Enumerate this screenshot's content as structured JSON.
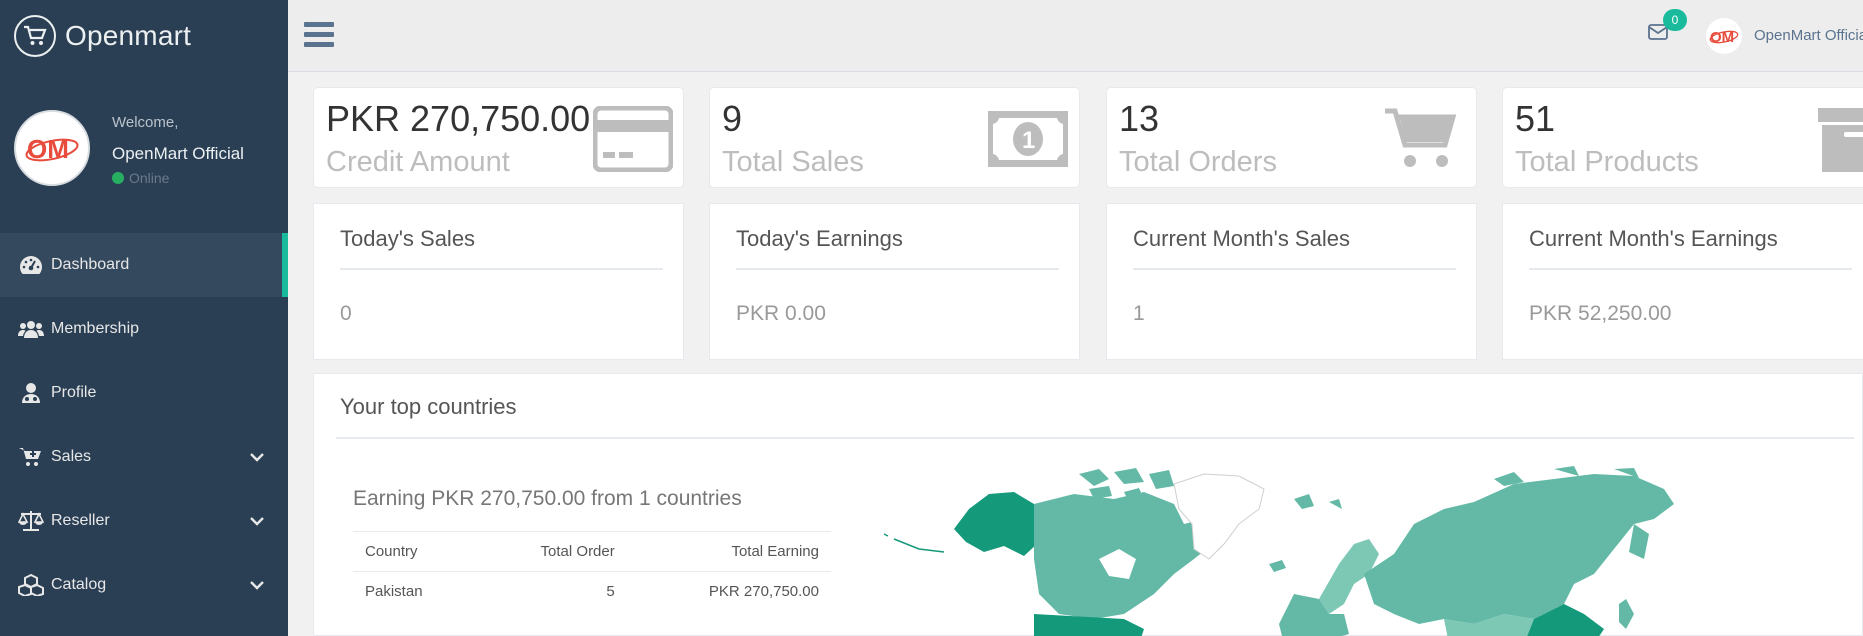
{
  "brand": {
    "name": "Openmart",
    "logo_icon": "cart-icon"
  },
  "profile": {
    "welcome": "Welcome,",
    "name": "OpenMart Official",
    "status": "Online",
    "avatar_text": "OM"
  },
  "menu": [
    {
      "label": "Dashboard",
      "icon": "dashboard-icon",
      "active": true
    },
    {
      "label": "Membership",
      "icon": "users-icon"
    },
    {
      "label": "Profile",
      "icon": "user-md-icon"
    },
    {
      "label": "Sales",
      "icon": "cart-plus-icon",
      "has_children": true
    },
    {
      "label": "Reseller",
      "icon": "balance-scale-icon",
      "has_children": true
    },
    {
      "label": "Catalog",
      "icon": "cubes-icon",
      "has_children": true
    }
  ],
  "topbar": {
    "mail_count": "0",
    "user_name": "OpenMart Official",
    "avatar_text": "OM"
  },
  "tiles": [
    {
      "count": "PKR 270,750.00",
      "label": "Credit Amount",
      "icon": "credit-card-icon"
    },
    {
      "count": "9",
      "label": "Total Sales",
      "icon": "money-icon"
    },
    {
      "count": "13",
      "label": "Total Orders",
      "icon": "shopping-cart-icon"
    },
    {
      "count": "51",
      "label": "Total Products",
      "icon": "archive-icon"
    }
  ],
  "panels": [
    {
      "title": "Today's Sales",
      "value": "0"
    },
    {
      "title": "Today's Earnings",
      "value": "PKR 0.00"
    },
    {
      "title": "Current Month's Sales",
      "value": "1"
    },
    {
      "title": "Current Month's Earnings",
      "value": "PKR 52,250.00"
    }
  ],
  "countries": {
    "title": "Your top countries",
    "summary": "Earning PKR 270,750.00 from 1 countries",
    "headers": [
      "Country",
      "Total Order",
      "Total Earning"
    ],
    "rows": [
      [
        "Pakistan",
        "5",
        "PKR 270,750.00"
      ]
    ]
  },
  "colors": {
    "sidebar": "#2a3f54",
    "accent": "#1abb9c",
    "map_fill": "#63b9a6",
    "map_dark": "#14997a"
  }
}
